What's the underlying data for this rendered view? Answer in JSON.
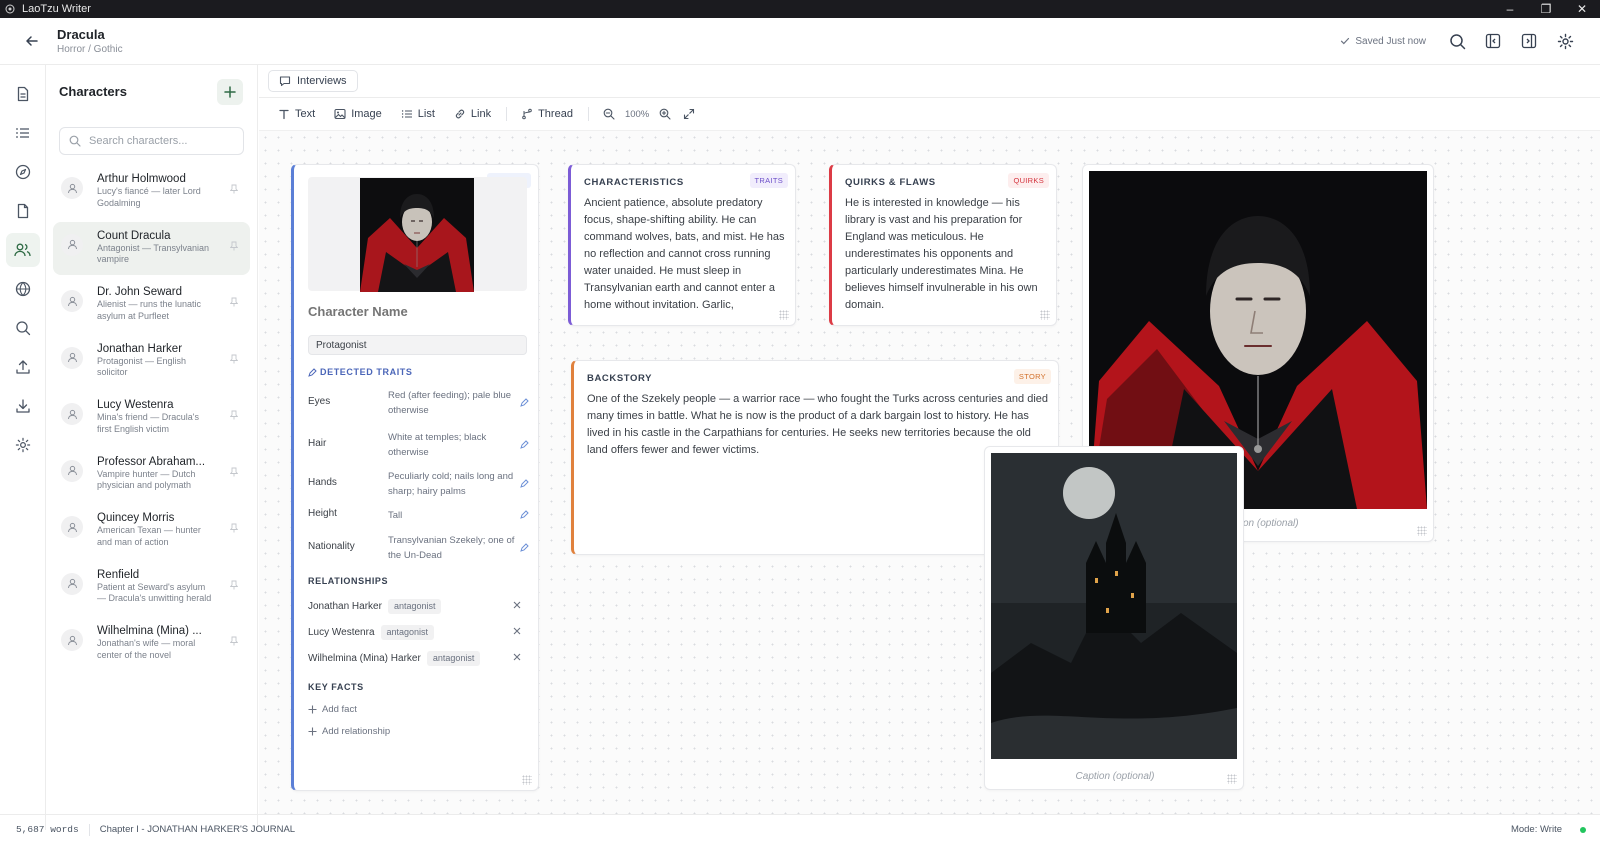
{
  "window": {
    "app_title": "LaoTzu Writer",
    "minimize": "–",
    "maximize": "❐",
    "close": "✕"
  },
  "header": {
    "title": "Dracula",
    "genre": "Horror / Gothic",
    "save_status": "Saved Just now"
  },
  "characters_panel": {
    "title": "Characters",
    "search_placeholder": "Search characters...",
    "items": [
      {
        "name": "Arthur Holmwood",
        "desc": "Lucy's fiancé — later Lord Godalming",
        "active": false
      },
      {
        "name": "Count Dracula",
        "desc": "Antagonist — Transylvanian vampire",
        "active": true
      },
      {
        "name": "Dr. John Seward",
        "desc": "Alienist — runs the lunatic asylum at Purfleet",
        "active": false
      },
      {
        "name": "Jonathan Harker",
        "desc": "Protagonist — English solicitor",
        "active": false
      },
      {
        "name": "Lucy Westenra",
        "desc": "Mina's friend — Dracula's first English victim",
        "active": false
      },
      {
        "name": "Professor Abraham...",
        "desc": "Vampire hunter — Dutch physician and polymath",
        "active": false
      },
      {
        "name": "Quincey Morris",
        "desc": "American Texan — hunter and man of action",
        "active": false
      },
      {
        "name": "Renfield",
        "desc": "Patient at Seward's asylum — Dracula's unwitting herald",
        "active": false
      },
      {
        "name": "Wilhelmina (Mina) ...",
        "desc": "Jonathan's wife — moral center of the novel",
        "active": false
      }
    ]
  },
  "tabs": [
    {
      "label": "Interviews"
    }
  ],
  "toolbar": {
    "text": "Text",
    "image": "Image",
    "list": "List",
    "link": "Link",
    "thread": "Thread",
    "zoom": "100%"
  },
  "profile_card": {
    "badge": "PROFILE",
    "name_placeholder": "Character Name",
    "role": "Protagonist",
    "detected_label": "DETECTED TRAITS",
    "traits": [
      {
        "key": "Eyes",
        "value": "Red (after feeding); pale blue otherwise"
      },
      {
        "key": "Hair",
        "value": "White at temples; black otherwise"
      },
      {
        "key": "Hands",
        "value": "Peculiarly cold; nails long and sharp; hairy palms"
      },
      {
        "key": "Height",
        "value": "Tall"
      },
      {
        "key": "Nationality",
        "value": "Transylvanian Szekely; one of the Un-Dead"
      }
    ],
    "relationships_label": "RELATIONSHIPS",
    "relationships": [
      {
        "name": "Jonathan Harker",
        "type": "antagonist"
      },
      {
        "name": "Lucy Westenra",
        "type": "antagonist"
      },
      {
        "name": "Wilhelmina (Mina) Harker",
        "type": "antagonist"
      }
    ],
    "key_facts_label": "KEY FACTS",
    "add_fact": "Add fact",
    "add_relationship": "Add relationship"
  },
  "traits_card": {
    "label": "CHARACTERISTICS",
    "badge": "TRAITS",
    "body": "Ancient patience, absolute predatory focus, shape-shifting ability. He can command wolves, bats, and mist. He has no reflection and cannot cross running water unaided. He must sleep in Transylvanian earth and cannot enter a home without invitation. Garlic,"
  },
  "quirks_card": {
    "label": "QUIRKS & FLAWS",
    "badge": "QUIRKS",
    "body": "He is interested in knowledge — his library is vast and his preparation for England was meticulous. He underestimates his opponents and particularly underestimates Mina. He believes himself invulnerable in his own domain."
  },
  "story_card": {
    "label": "BACKSTORY",
    "badge": "STORY",
    "body": "One of the Szekely people — a warrior race — who fought the Turks across centuries and died many times in battle. What he is now is the product of a dark bargain lost to history. He has lived in his castle in the Carpathians for centuries. He seeks new territories because the old land offers fewer and fewer victims."
  },
  "image_cards": [
    {
      "caption": "Caption (optional)",
      "visible_caption": "on (optional)"
    },
    {
      "caption": "Caption (optional)"
    }
  ],
  "status_bar": {
    "words": "5,687 words",
    "chapter": "Chapter I - JONATHAN HARKER'S JOURNAL",
    "mode": "Mode: Write"
  },
  "colors": {
    "profile": "#5b7fd6",
    "traits": "#7c5cd6",
    "quirks": "#dc3b45",
    "story": "#e0813d",
    "online": "#22c55e"
  },
  "icons": [
    "back-arrow-icon",
    "check-icon",
    "search-icon",
    "panel-left-icon",
    "panel-right-icon",
    "gear-icon",
    "document-icon",
    "list-icon",
    "compass-icon",
    "file-icon",
    "users-icon",
    "globe-icon",
    "upload-icon",
    "download-icon",
    "plus-icon",
    "user-icon",
    "pin-icon",
    "message-icon",
    "text-icon",
    "image-icon",
    "link-icon",
    "thread-icon",
    "zoom-out-icon",
    "zoom-in-icon",
    "expand-icon",
    "edit-icon"
  ]
}
